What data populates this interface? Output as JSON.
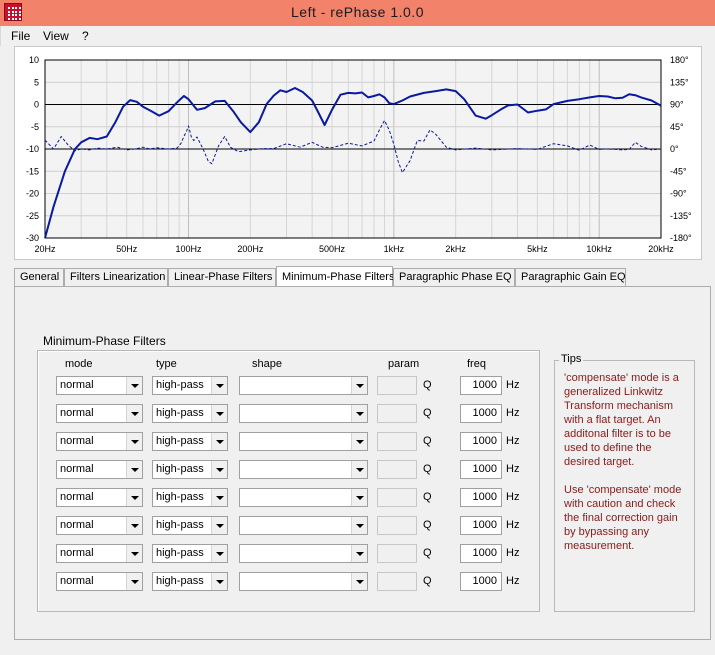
{
  "window": {
    "title": "Left  -  rePhase 1.0.0",
    "brand_color": "#f2826a"
  },
  "menu": {
    "items": [
      "File",
      "View",
      "?"
    ]
  },
  "chart_data": {
    "type": "line",
    "x_scale": "log",
    "xlim": [
      20,
      20000
    ],
    "ylim_left": [
      -30,
      10
    ],
    "ylim_right": [
      -180,
      180
    ],
    "x_ticks": [
      {
        "v": 20,
        "label": "20Hz"
      },
      {
        "v": 50,
        "label": "50Hz"
      },
      {
        "v": 100,
        "label": "100Hz"
      },
      {
        "v": 200,
        "label": "200Hz"
      },
      {
        "v": 500,
        "label": "500Hz"
      },
      {
        "v": 1000,
        "label": "1kHz"
      },
      {
        "v": 2000,
        "label": "2kHz"
      },
      {
        "v": 5000,
        "label": "5kHz"
      },
      {
        "v": 10000,
        "label": "10kHz"
      },
      {
        "v": 20000,
        "label": "20kHz"
      }
    ],
    "y_ticks_left": [
      "10",
      "5",
      "0",
      "-5",
      "-10",
      "-15",
      "-20",
      "-25",
      "-30"
    ],
    "y_ticks_right": [
      "180°",
      "135°",
      "90°",
      "45°",
      "0°",
      "-45°",
      "-90°",
      "-135°",
      "-180°"
    ],
    "grid": true,
    "reference_lines": [
      0,
      -10
    ],
    "series": [
      {
        "style": "solid",
        "color": "#0a1aa0",
        "axis": "left",
        "x": [
          20,
          22,
          25,
          28,
          30,
          33,
          36,
          40,
          44,
          48,
          52,
          56,
          60,
          66,
          72,
          80,
          88,
          95,
          100,
          110,
          120,
          135,
          150,
          165,
          180,
          200,
          220,
          240,
          260,
          280,
          300,
          330,
          360,
          400,
          430,
          460,
          500,
          550,
          600,
          650,
          700,
          750,
          800,
          850,
          900,
          950,
          1000,
          1100,
          1200,
          1400,
          1600,
          1800,
          2000,
          2200,
          2500,
          2800,
          3000,
          3300,
          3600,
          4000,
          4500,
          5000,
          5500,
          6000,
          7000,
          8000,
          9000,
          10000,
          11000,
          12000,
          13000,
          14000,
          15000,
          16000,
          18000,
          20000
        ],
        "y": [
          -30,
          -23,
          -15,
          -10,
          -8.5,
          -7.5,
          -7.8,
          -7.2,
          -4,
          -0.5,
          1,
          0.6,
          -0.5,
          -1.5,
          -2.5,
          -1.5,
          0.5,
          1.9,
          1.2,
          -1.2,
          -0.8,
          0.7,
          0.8,
          -1.5,
          -4,
          -6.2,
          -4,
          0.1,
          2,
          3.2,
          2.8,
          3.7,
          2.8,
          0.9,
          -1.9,
          -4.6,
          -1.2,
          2.2,
          2.6,
          2.5,
          2.7,
          1.6,
          1.9,
          2.3,
          1.6,
          0.3,
          0.1,
          0.9,
          1.8,
          2.6,
          3,
          3.4,
          3,
          1.2,
          -2.5,
          -3.2,
          -2.4,
          -1.2,
          -0.2,
          0,
          -1.8,
          -1.4,
          -1.1,
          0.1,
          0.8,
          1.2,
          1.6,
          1.9,
          1.8,
          1.4,
          1.5,
          2.3,
          2.1,
          1.6,
          0.9,
          -0.3
        ]
      },
      {
        "style": "dashed",
        "color": "#0a1aa0",
        "axis": "left",
        "x": [
          20,
          22,
          24,
          26,
          28,
          30,
          33,
          36,
          40,
          45,
          50,
          55,
          60,
          65,
          70,
          80,
          88,
          92,
          95,
          98,
          100,
          103,
          106,
          110,
          118,
          125,
          130,
          140,
          150,
          160,
          175,
          200,
          230,
          260,
          300,
          350,
          400,
          450,
          500,
          550,
          600,
          700,
          800,
          850,
          900,
          950,
          1000,
          1050,
          1100,
          1200,
          1300,
          1400,
          1500,
          1600,
          1800,
          2000,
          2500,
          3000,
          4000,
          5000,
          5500,
          6000,
          7000,
          8000,
          9000,
          10000,
          11000,
          12000,
          13000,
          14000,
          15000,
          16000,
          18000,
          20000
        ],
        "y": [
          -8,
          -10,
          -7.2,
          -9.2,
          -10.4,
          -10,
          -10.2,
          -9.8,
          -10,
          -9.6,
          -10.2,
          -10,
          -9.6,
          -10,
          -9.7,
          -10,
          -9.8,
          -8.7,
          -7.2,
          -5.9,
          -4.8,
          -7.2,
          -8.1,
          -7.3,
          -10.1,
          -12.8,
          -13.3,
          -9.3,
          -7.2,
          -9.6,
          -10.6,
          -10.2,
          -9.9,
          -9.9,
          -8.8,
          -9.6,
          -8.5,
          -9.6,
          -9.7,
          -9.2,
          -8.7,
          -9.3,
          -8.2,
          -5.7,
          -3.6,
          -5.8,
          -9,
          -12.8,
          -15.3,
          -12.6,
          -8.1,
          -8.2,
          -5.7,
          -6.7,
          -9.6,
          -10.2,
          -9.8,
          -10.2,
          -9.9,
          -10.1,
          -9.4,
          -8.8,
          -9.3,
          -10.3,
          -9.1,
          -10.1,
          -10,
          -10.1,
          -10.2,
          -10.1,
          -8.5,
          -9.4,
          -10.2,
          -10
        ]
      }
    ]
  },
  "tabs": [
    {
      "label": "General",
      "active": false
    },
    {
      "label": "Filters Linearization",
      "active": false
    },
    {
      "label": "Linear-Phase Filters",
      "active": false
    },
    {
      "label": "Minimum-Phase Filters",
      "active": true
    },
    {
      "label": "Paragraphic Phase EQ",
      "active": false
    },
    {
      "label": "Paragraphic Gain EQ",
      "active": false
    }
  ],
  "filters": {
    "title": "Minimum-Phase Filters",
    "columns": {
      "mode": "mode",
      "type": "type",
      "shape": "shape",
      "param": "param",
      "freq": "freq"
    },
    "rows": [
      {
        "mode": "normal",
        "type": "high-pass",
        "shape": "",
        "param": "",
        "q": "Q",
        "freq": "1000",
        "unit": "Hz"
      },
      {
        "mode": "normal",
        "type": "high-pass",
        "shape": "",
        "param": "",
        "q": "Q",
        "freq": "1000",
        "unit": "Hz"
      },
      {
        "mode": "normal",
        "type": "high-pass",
        "shape": "",
        "param": "",
        "q": "Q",
        "freq": "1000",
        "unit": "Hz"
      },
      {
        "mode": "normal",
        "type": "high-pass",
        "shape": "",
        "param": "",
        "q": "Q",
        "freq": "1000",
        "unit": "Hz"
      },
      {
        "mode": "normal",
        "type": "high-pass",
        "shape": "",
        "param": "",
        "q": "Q",
        "freq": "1000",
        "unit": "Hz"
      },
      {
        "mode": "normal",
        "type": "high-pass",
        "shape": "",
        "param": "",
        "q": "Q",
        "freq": "1000",
        "unit": "Hz"
      },
      {
        "mode": "normal",
        "type": "high-pass",
        "shape": "",
        "param": "",
        "q": "Q",
        "freq": "1000",
        "unit": "Hz"
      },
      {
        "mode": "normal",
        "type": "high-pass",
        "shape": "",
        "param": "",
        "q": "Q",
        "freq": "1000",
        "unit": "Hz"
      }
    ]
  },
  "tips": {
    "title": "Tips",
    "text_color": "#8b1a1a",
    "paragraphs": [
      "'compensate' mode is a generalized Linkwitz Transform mechanism with a flat target. An additonal filter is to be used to define the desired target.",
      "Use 'compensate' mode with caution and check the final correction gain by bypassing any measurement."
    ]
  }
}
